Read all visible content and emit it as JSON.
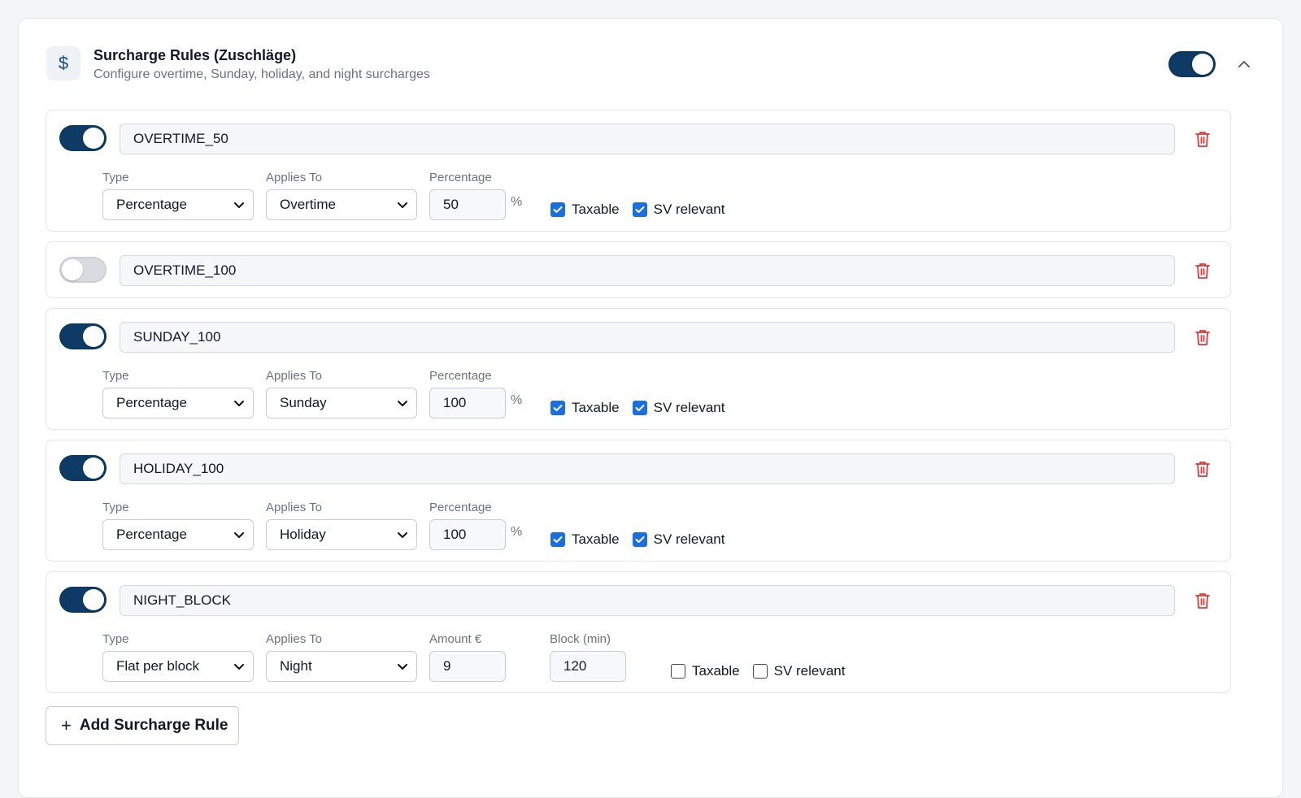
{
  "header": {
    "icon": "dollar-icon",
    "icon_glyph": "$",
    "title": "Surcharge Rules (Zuschläge)",
    "subtitle": "Configure overtime, Sunday, holiday, and night surcharges",
    "enabled": true
  },
  "labels": {
    "type": "Type",
    "applies_to": "Applies To",
    "percentage": "Percentage",
    "amount": "Amount €",
    "block": "Block (min)",
    "percent_sign": "%",
    "taxable": "Taxable",
    "sv_relevant": "SV relevant"
  },
  "rules": [
    {
      "name": "OVERTIME_50",
      "enabled": true,
      "type": "Percentage",
      "applies_to": "Overtime",
      "value": "50",
      "taxable": true,
      "sv_relevant": true
    },
    {
      "name": "OVERTIME_100",
      "enabled": false
    },
    {
      "name": "SUNDAY_100",
      "enabled": true,
      "type": "Percentage",
      "applies_to": "Sunday",
      "value": "100",
      "taxable": true,
      "sv_relevant": true
    },
    {
      "name": "HOLIDAY_100",
      "enabled": true,
      "type": "Percentage",
      "applies_to": "Holiday",
      "value": "100",
      "taxable": true,
      "sv_relevant": true
    },
    {
      "name": "NIGHT_BLOCK",
      "enabled": true,
      "type": "Flat per block",
      "applies_to": "Night",
      "value": "9",
      "block": "120",
      "taxable": false,
      "sv_relevant": false
    }
  ],
  "add_button": {
    "icon": "plus-icon",
    "label": "Add Surcharge Rule"
  },
  "colors": {
    "toggle_on": "#0d3b66",
    "toggle_off": "#d8dbe0",
    "checkbox": "#1a6fe0",
    "delete": "#d93a3a"
  }
}
